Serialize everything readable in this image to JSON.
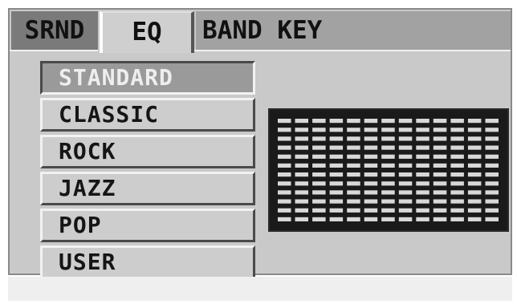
{
  "tabs": [
    {
      "id": "srnd",
      "label": "SRND",
      "active": false
    },
    {
      "id": "eq",
      "label": "EQ",
      "active": true
    },
    {
      "id": "bandkey",
      "label": "BAND KEY",
      "active": false
    }
  ],
  "presets": [
    {
      "label": "STANDARD",
      "selected": true
    },
    {
      "label": "CLASSIC",
      "selected": false
    },
    {
      "label": "ROCK",
      "selected": false
    },
    {
      "label": "JAZZ",
      "selected": false
    },
    {
      "label": "POP",
      "selected": false
    },
    {
      "label": "USER",
      "selected": false
    }
  ],
  "equalizer": {
    "band_count": 13,
    "segments_per_band": 12,
    "colors": {
      "background": "#1a1a1a",
      "segment": "#d8d8d8"
    }
  },
  "colors": {
    "panel": "#c9c9c9",
    "tab_srnd": "#7a7a7a",
    "tab_eq": "#cfcfcf",
    "tab_bandkey": "#a2a2a2",
    "selected_preset": "#9a9a9a"
  }
}
